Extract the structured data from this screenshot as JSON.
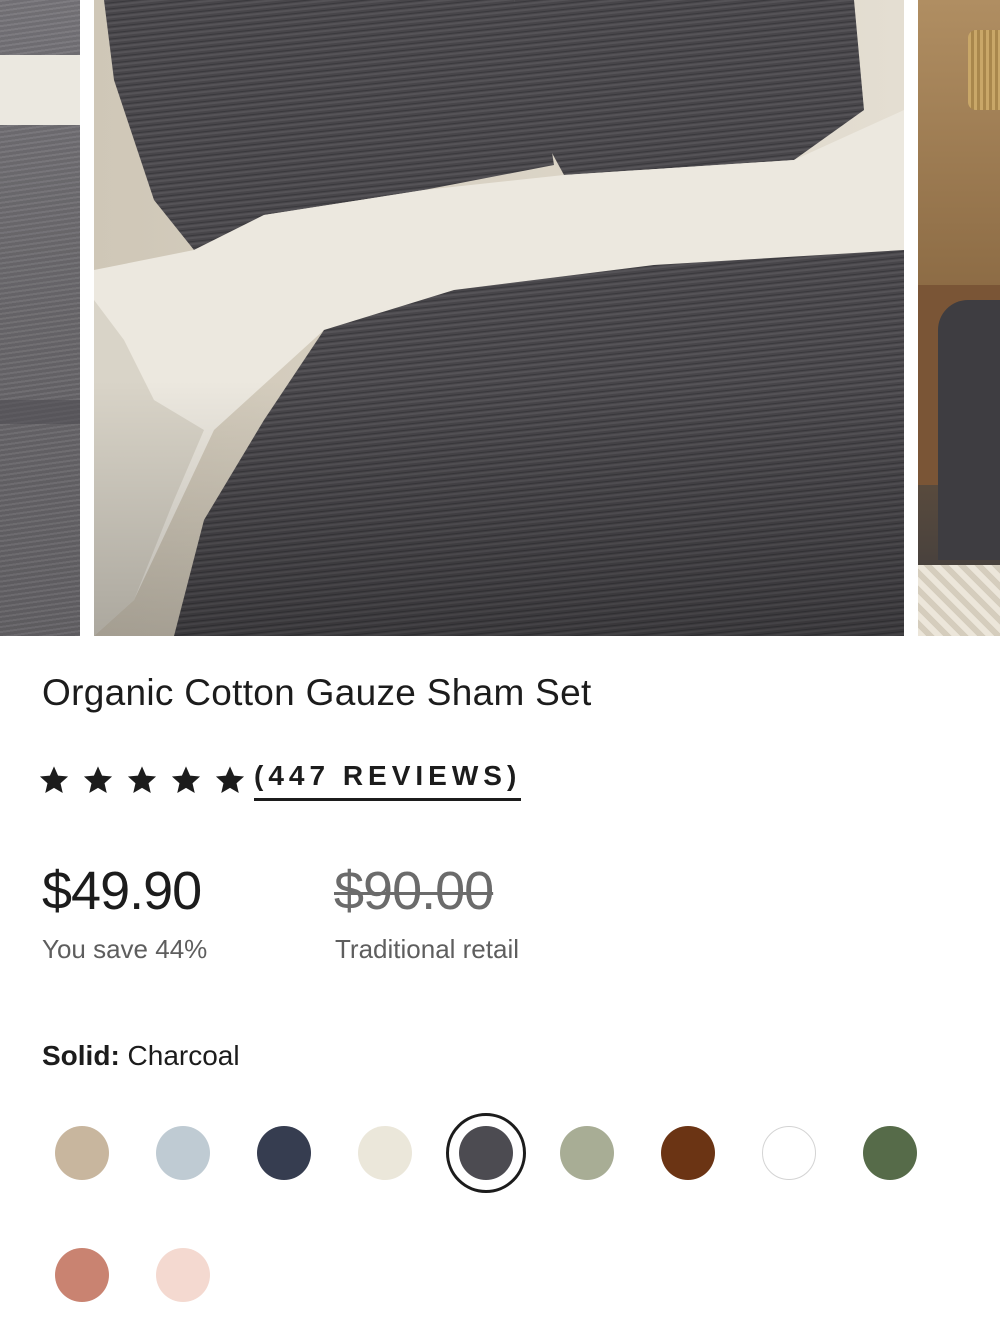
{
  "gallery": {
    "images": [
      {
        "name": "previous-image-gray-duvet"
      },
      {
        "name": "main-image-charcoal-sham-set"
      },
      {
        "name": "next-image-bedroom-scene"
      }
    ]
  },
  "product": {
    "title": "Organic Cotton Gauze Sham Set",
    "rating": {
      "stars": 5,
      "reviews_label": "(447 REVIEWS)"
    },
    "price": {
      "current": "$49.90",
      "save_text": "You save 44%",
      "original": "$90.00",
      "original_label": "Traditional retail"
    }
  },
  "color_selector": {
    "label": "Solid:",
    "selected": "Charcoal",
    "swatches": [
      {
        "color": "#c8b69e",
        "selected": false
      },
      {
        "color": "#bfcbd3",
        "selected": false
      },
      {
        "color": "#363d50",
        "selected": false
      },
      {
        "color": "#ebe7da",
        "selected": false
      },
      {
        "color": "#4c4b51",
        "selected": true
      },
      {
        "color": "#a8ad95",
        "selected": false
      },
      {
        "color": "#6b3414",
        "selected": false
      },
      {
        "color": "#ffffff",
        "selected": false
      },
      {
        "color": "#566b49",
        "selected": false
      },
      {
        "color": "#c98371",
        "selected": false
      },
      {
        "color": "#f4d9d0",
        "selected": false
      }
    ]
  }
}
